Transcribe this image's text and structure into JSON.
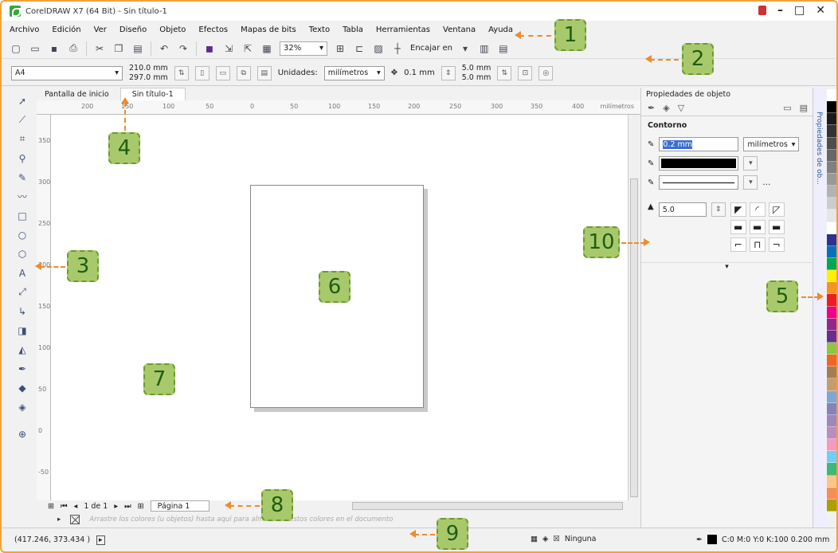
{
  "window": {
    "title": "CorelDRAW X7 (64 Bit) - Sin título-1"
  },
  "menu": [
    "Archivo",
    "Edición",
    "Ver",
    "Diseño",
    "Objeto",
    "Efectos",
    "Mapas de bits",
    "Texto",
    "Tabla",
    "Herramientas",
    "Ventana",
    "Ayuda"
  ],
  "toolbar": {
    "zoom": "32%",
    "snap_label": "Encajar en"
  },
  "propbar": {
    "page_size": "A4",
    "width": "210.0 mm",
    "height": "297.0 mm",
    "units_label": "Unidades:",
    "units_value": "milímetros",
    "nudge": "0.1 mm",
    "dup_x": "5.0 mm",
    "dup_y": "5.0 mm"
  },
  "tabs": {
    "home": "Pantalla de inicio",
    "doc": "Sin título-1"
  },
  "ruler": {
    "unit": "milímetros",
    "top_ticks": [
      "200",
      "150",
      "100",
      "50",
      "0",
      "50",
      "100",
      "150",
      "200",
      "250",
      "300",
      "350",
      "400"
    ],
    "left_ticks": [
      "350",
      "300",
      "250",
      "200",
      "150",
      "100",
      "50",
      "0",
      "-50"
    ]
  },
  "pagenav": {
    "count": "1 de 1",
    "page_label": "Página 1"
  },
  "docpalette": {
    "hint": "Arrastre los colores (u objetos) hasta aquí para almacenar estos colores en el documento"
  },
  "status": {
    "coords": "(417.246, 373.434 )",
    "fill_label": "Ninguna",
    "outline_info": "C:0 M:0 Y:0 K:100  0.200 mm"
  },
  "docker": {
    "title": "Propiedades de objeto",
    "section": "Contorno",
    "width_value": "0.2 mm",
    "width_units": "milímetros",
    "miter_value": "5.0",
    "vtab_label": "Propiedades de ob..."
  },
  "palette_colors": [
    "#ffffff",
    "#000000",
    "#1a1a1a",
    "#333333",
    "#4d4d4d",
    "#666666",
    "#808080",
    "#999999",
    "#b3b3b3",
    "#cccccc",
    "#e6e6e6",
    "#ffffff",
    "#2e3192",
    "#0072bc",
    "#00a651",
    "#fff200",
    "#f7941d",
    "#ed1c24",
    "#ec008c",
    "#92278f",
    "#662d91",
    "#8dc63f",
    "#f26522",
    "#a67c52",
    "#c69c6d",
    "#7da7d9",
    "#8781bd",
    "#a186be",
    "#bd8cbf",
    "#f49ac1",
    "#6dcff6",
    "#3cb878",
    "#fdc689",
    "#f68e56",
    "#aba000"
  ],
  "callouts": [
    "1",
    "2",
    "3",
    "4",
    "5",
    "6",
    "7",
    "8",
    "9",
    "10"
  ]
}
